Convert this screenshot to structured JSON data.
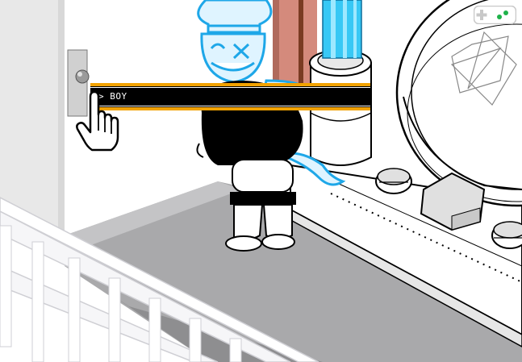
{
  "tooltip": {
    "prompt_symbol": ">",
    "label": "BOY"
  },
  "colors": {
    "tooltip_accent": "#f2a200",
    "tooltip_background": "#000000",
    "ghost_outline": "#1ea7e8",
    "ghost_fill": "#dff4ff",
    "aquarium_water": "#37c8f5",
    "wall_door_brown": "#7a3b22",
    "floor_gray": "#a9a9ab",
    "controller_green": "#1fb24a"
  },
  "icons": {
    "cursor": "hand-pointer-icon",
    "controller": "gamepad-icon"
  }
}
